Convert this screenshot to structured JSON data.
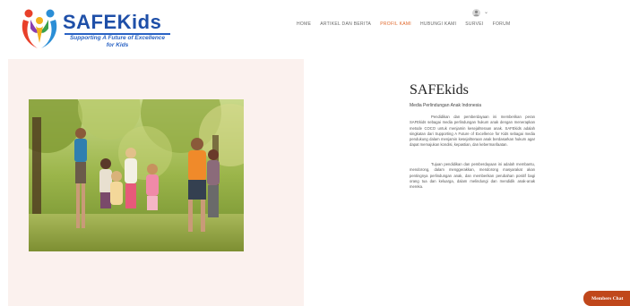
{
  "logo": {
    "title": "SAFEKids",
    "tagline": "Supporting A Future of Excellence for Kids"
  },
  "nav": {
    "items": [
      {
        "label": "HOME",
        "active": false
      },
      {
        "label": "ARTIKEL DAN BERITA",
        "active": false
      },
      {
        "label": "PROFIL KAMI",
        "active": true
      },
      {
        "label": "HUBUNGI KAMI",
        "active": false
      },
      {
        "label": "SURVEI",
        "active": false
      },
      {
        "label": "FORUM",
        "active": false
      }
    ],
    "active_color": "#e0672a"
  },
  "user_menu": {
    "icon": "user-icon",
    "chevron": "⌄"
  },
  "about": {
    "title": "SAFEkids",
    "subtitle": "Media Perlindungan Anak Indonesia",
    "paragraph1": "Pendidikan dan pemberdayaan ini memberikan peran SAFEkids sebagai media perlindungan hukum anak dengan menerapkan metode COCO untuk menjamin kesejahteraan anak. SAFEkids adalah singkatan dari Supporting A Future of Excellence for Kids sebagai media pendukung dalam menjamin kesejahteraan anak berdasarkan hukum agar dapat memajukan kondisi, kepastian, dan kebermanfaatan.",
    "paragraph2": "Tujuan pendidikan dan pemberdayaan ini adalah membantu, mendorong, dalam menggerakkan, mendorong masyarakat akan pentingnya perlindungan anak, dan memberikan perubahan positif bagi orang tua dan keluarga, dalam melindungi dan mendidik anak-anak mereka."
  },
  "photo": {
    "alt": "children-playing-photo"
  },
  "chat": {
    "label": "Members Chat"
  },
  "colors": {
    "brand_blue": "#1e4fa8",
    "panel_bg": "#fbf1ee",
    "chat_bg": "#c0471b"
  }
}
